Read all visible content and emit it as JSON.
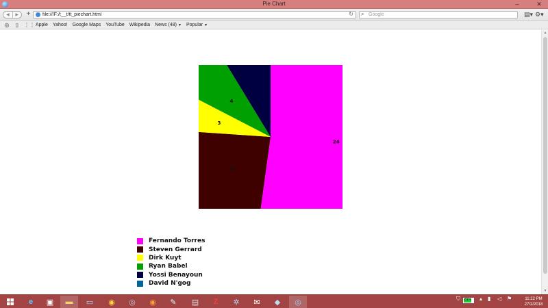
{
  "window": {
    "title": "Pie Chart",
    "minimize": "–",
    "close": "✕"
  },
  "toolbar": {
    "back": "◀",
    "forward": "▶",
    "new_tab": "+",
    "url": "file:///F:/t__t/tt_piechart.html",
    "reload_icon": "reload-icon",
    "search_placeholder": "Google",
    "page_menu_icon": "page-icon",
    "settings_icon": "gear-icon"
  },
  "bookmarks": {
    "items": [
      {
        "label": "Apple"
      },
      {
        "label": "Yahoo!"
      },
      {
        "label": "Google Maps"
      },
      {
        "label": "YouTube"
      },
      {
        "label": "Wikipedia"
      },
      {
        "label": "News (48)",
        "dropdown": true
      },
      {
        "label": "Popular",
        "dropdown": true
      }
    ]
  },
  "chart_data": {
    "type": "pie",
    "title": "",
    "slices": [
      {
        "label": "Fernando Torres",
        "value": 24,
        "color": "#FF00FF",
        "data_label": "24"
      },
      {
        "label": "Steven Gerrard",
        "value": 11,
        "color": "#3F0000",
        "data_label": "11"
      },
      {
        "label": "Dirk Kuyt",
        "value": 3,
        "color": "#FFFF00",
        "data_label": "3"
      },
      {
        "label": "Ryan Babel",
        "value": 4,
        "color": "#00A000",
        "data_label": "4"
      },
      {
        "label": "Yossi Benayoun",
        "value": 4,
        "color": "#000040",
        "data_label": ""
      },
      {
        "label": "David N'gog",
        "value": 0,
        "color": "#006699",
        "data_label": ""
      }
    ],
    "legend_placement": "bottom-left"
  },
  "taskbar": {
    "apps": [
      "ie-icon",
      "store-icon",
      "file-explorer-icon",
      "computer-icon",
      "chrome-icon",
      "app-icon",
      "firefox-icon",
      "edit-icon",
      "app-icon",
      "filezilla-icon",
      "app-icon",
      "mail-icon",
      "app-icon",
      "safari-icon"
    ],
    "battery_percent": "81%",
    "battery_level": 0.81,
    "time": "11:22 PM",
    "date": "27/2/2018"
  }
}
